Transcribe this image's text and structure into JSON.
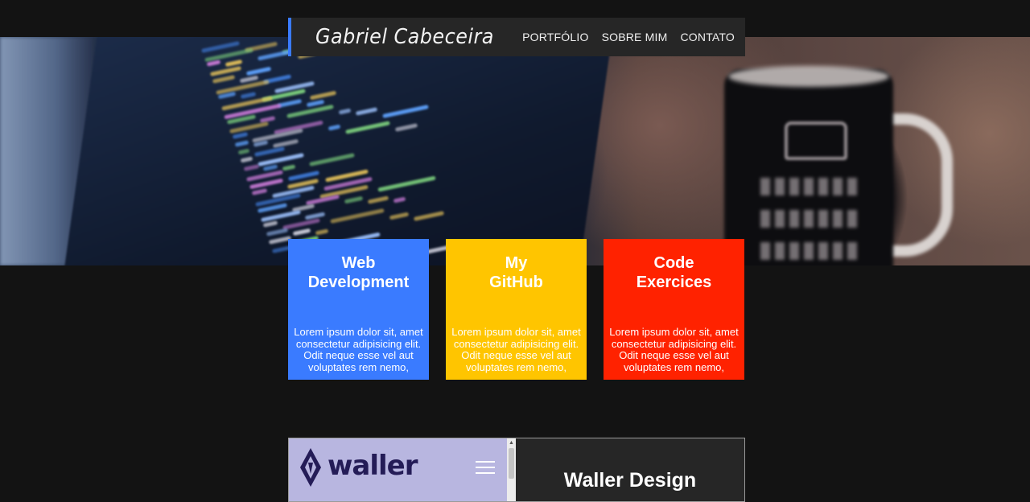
{
  "brand": "Gabriel Cabeceira",
  "nav": [
    "PORTFÓLIO",
    "SOBRE MIM",
    "CONTATO"
  ],
  "cards": [
    {
      "title": "Web\nDevelopment",
      "desc": "Lorem ipsum dolor sit, amet consectetur adipisicing elit. Odit neque esse vel aut voluptates rem nemo,",
      "color": "#3a7bff"
    },
    {
      "title": "My\nGitHub",
      "desc": "Lorem ipsum dolor sit, amet consectetur adipisicing elit. Odit neque esse vel aut voluptates rem nemo,",
      "color": "#ffc500"
    },
    {
      "title": "Code\nExercices",
      "desc": "Lorem ipsum dolor sit, amet consectetur adipisicing elit. Odit neque esse vel aut voluptates rem nemo,",
      "color": "#ff2200"
    }
  ],
  "project": {
    "logo_text": "waller",
    "title": "Waller Design"
  },
  "colors": {
    "accent": "#3a7bff",
    "header_bg": "#262626",
    "page_bg": "#131313"
  }
}
